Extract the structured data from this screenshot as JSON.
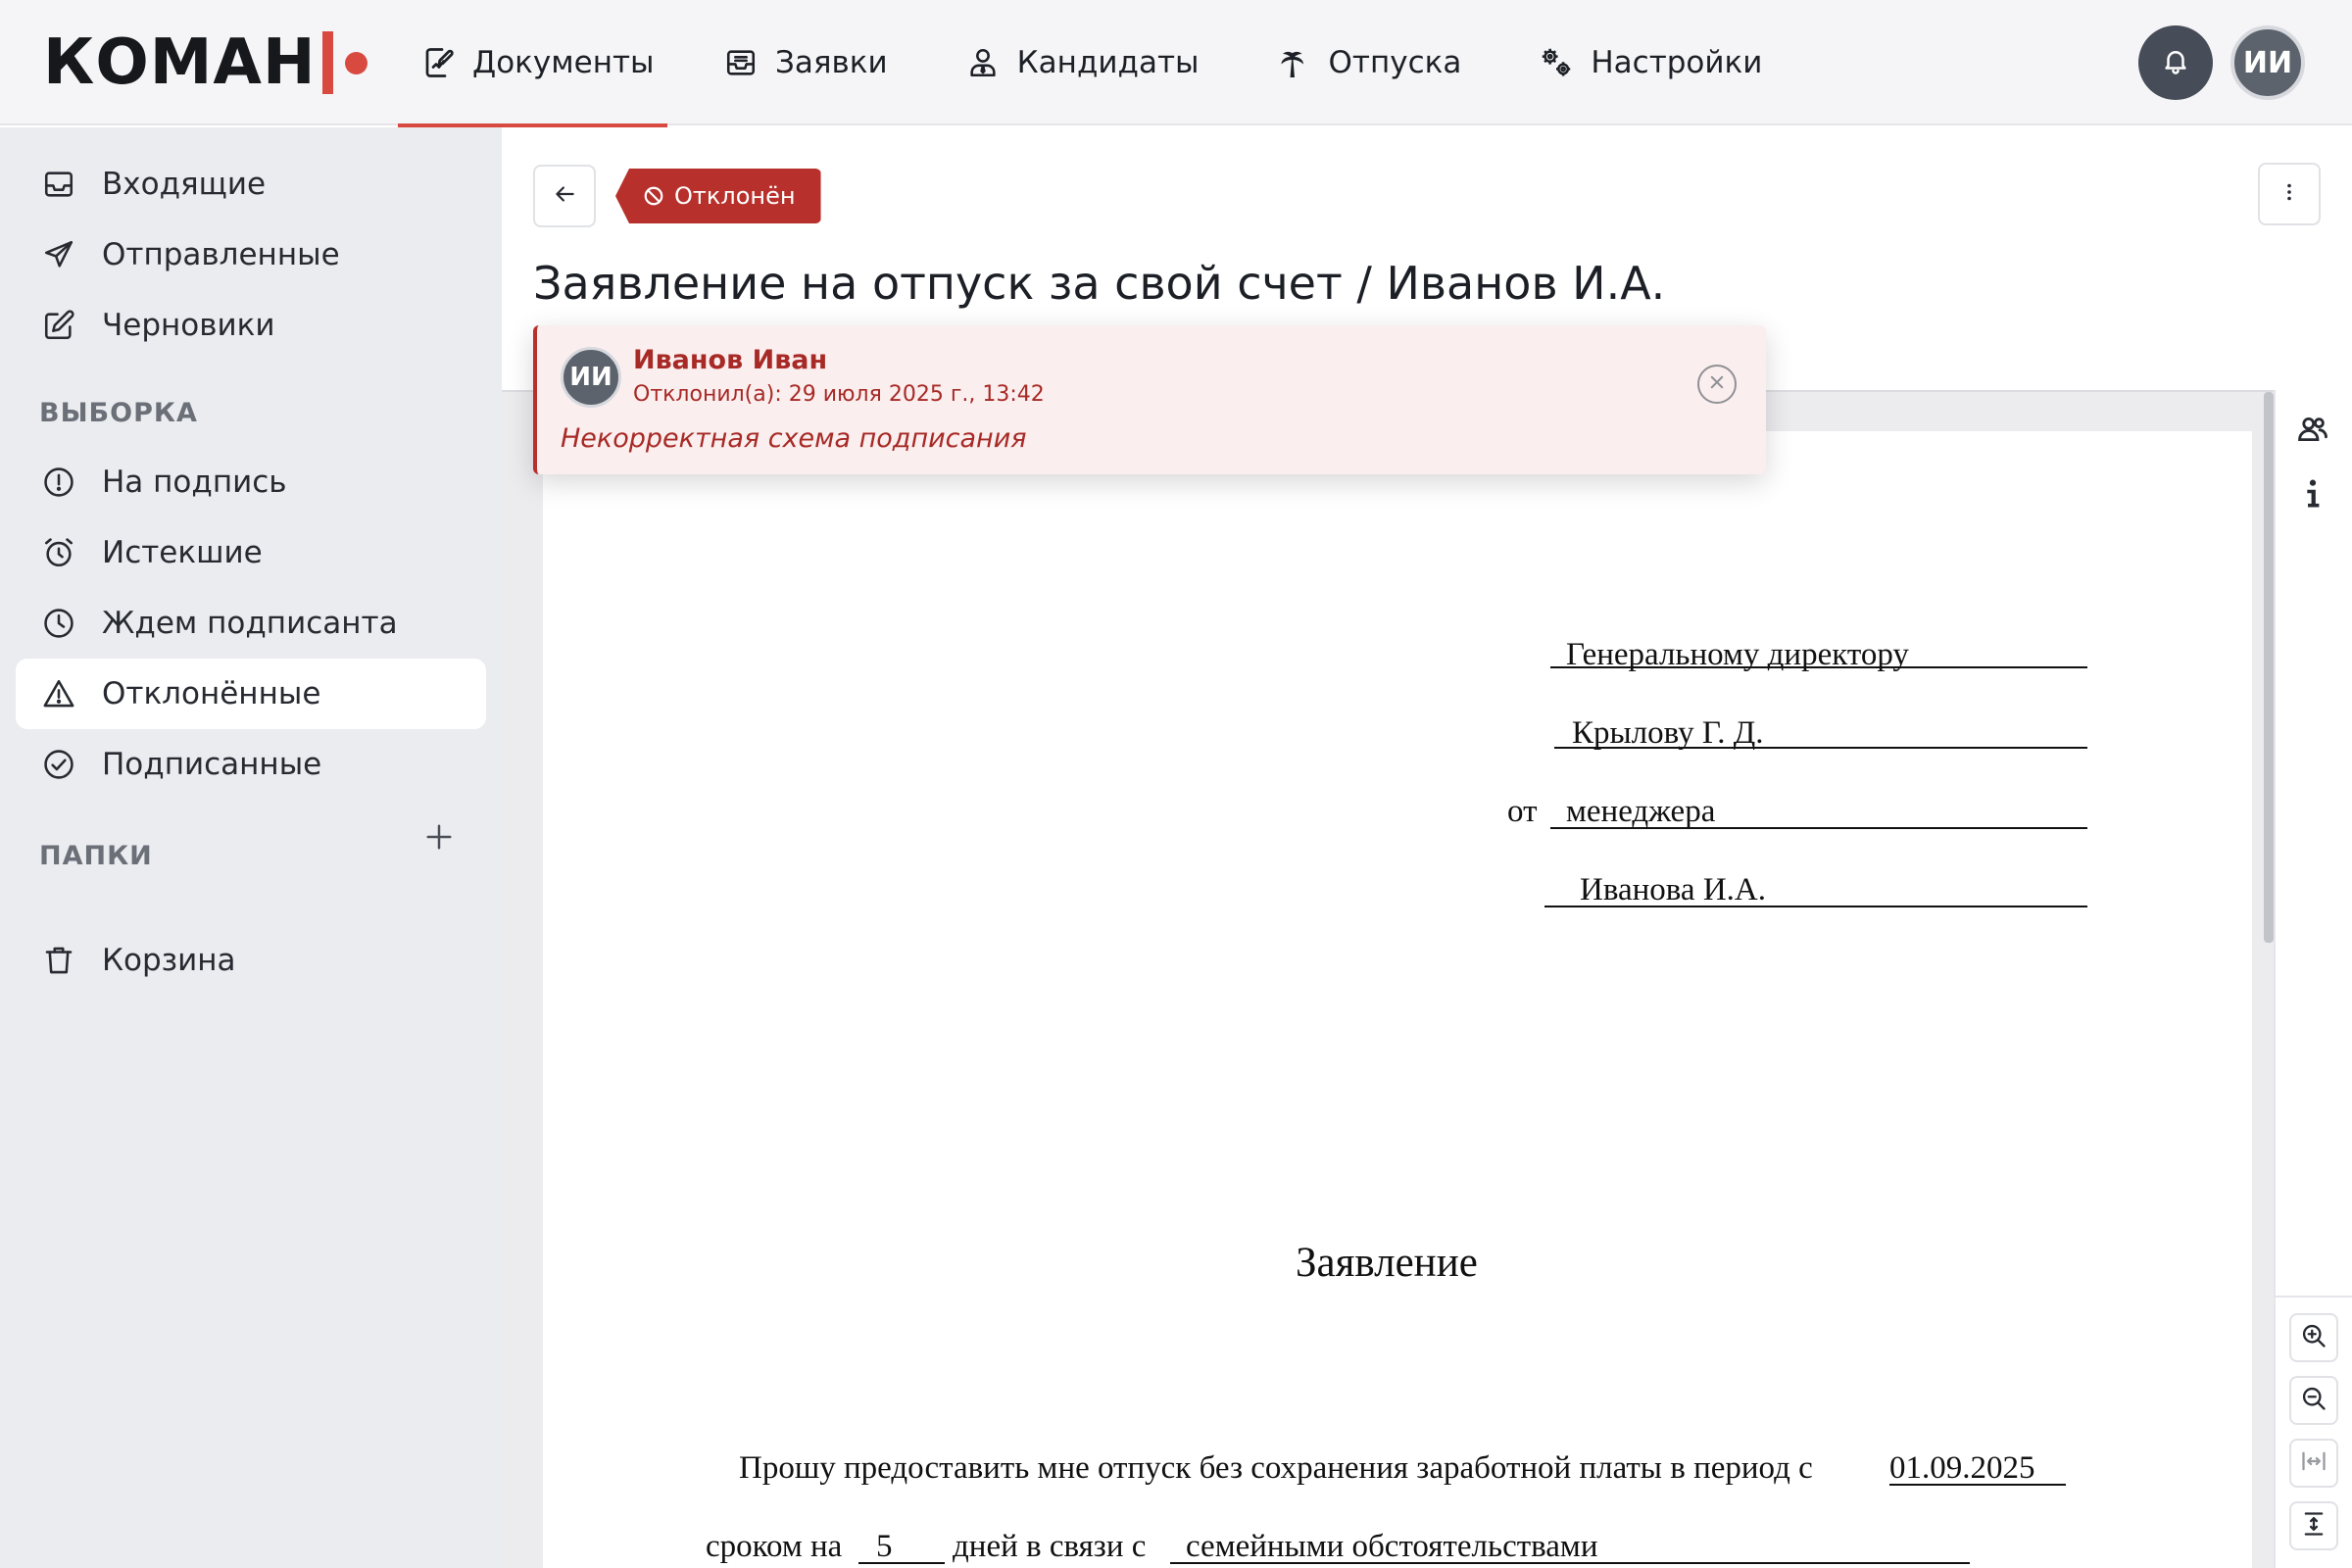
{
  "header": {
    "logo_text": "КОМАН",
    "nav": [
      {
        "label": "Документы",
        "icon": "document-edit-icon",
        "active": true
      },
      {
        "label": "Заявки",
        "icon": "inbox-tray-icon"
      },
      {
        "label": "Кандидаты",
        "icon": "user-tie-icon"
      },
      {
        "label": "Отпуска",
        "icon": "palm-tree-icon"
      },
      {
        "label": "Настройки",
        "icon": "gears-icon"
      }
    ],
    "avatar_initials": "ИИ"
  },
  "sidebar": {
    "items": [
      {
        "label": "Входящие",
        "icon": "inbox-icon"
      },
      {
        "label": "Отправленные",
        "icon": "paper-plane-icon"
      },
      {
        "label": "Черновики",
        "icon": "edit-icon"
      }
    ],
    "filter_heading": "ВЫБОРКА",
    "filters": [
      {
        "label": "На подпись",
        "icon": "exclamation-circle-icon"
      },
      {
        "label": "Истекшие",
        "icon": "alarm-clock-icon"
      },
      {
        "label": "Ждем подписанта",
        "icon": "clock-icon"
      },
      {
        "label": "Отклонённые",
        "icon": "warning-triangle-icon",
        "active": true
      },
      {
        "label": "Подписанные",
        "icon": "check-circle-icon"
      }
    ],
    "folders_heading": "ПАПКИ",
    "trash_label": "Корзина"
  },
  "document": {
    "status_label": "Отклонён",
    "title": "Заявление на отпуск за свой счет / Иванов И.А.",
    "body": {
      "addressee_1": "Генеральному директору",
      "addressee_2": "Крылову Г. Д.",
      "from_prefix": "от",
      "from_position": "менеджера",
      "from_name": "Иванова И.А.",
      "heading": "Заявление",
      "line1_text": "Прошу предоставить мне отпуск без сохранения заработной платы в период с",
      "line1_date": "01.09.2025",
      "line2_prefix": "сроком на",
      "line2_days": "5",
      "line2_middle": "дней в связи с",
      "line2_reason": "семейными обстоятельствами"
    }
  },
  "rejection": {
    "avatar_initials": "ИИ",
    "name": "Иванов Иван",
    "meta": "Отклонил(а): 29 июля 2025 г., 13:42",
    "comment": "Некорректная схема подписания"
  },
  "colors": {
    "accent": "#d84a40",
    "rejected": "#b7302b",
    "sidebar_bg": "#ebecef"
  }
}
